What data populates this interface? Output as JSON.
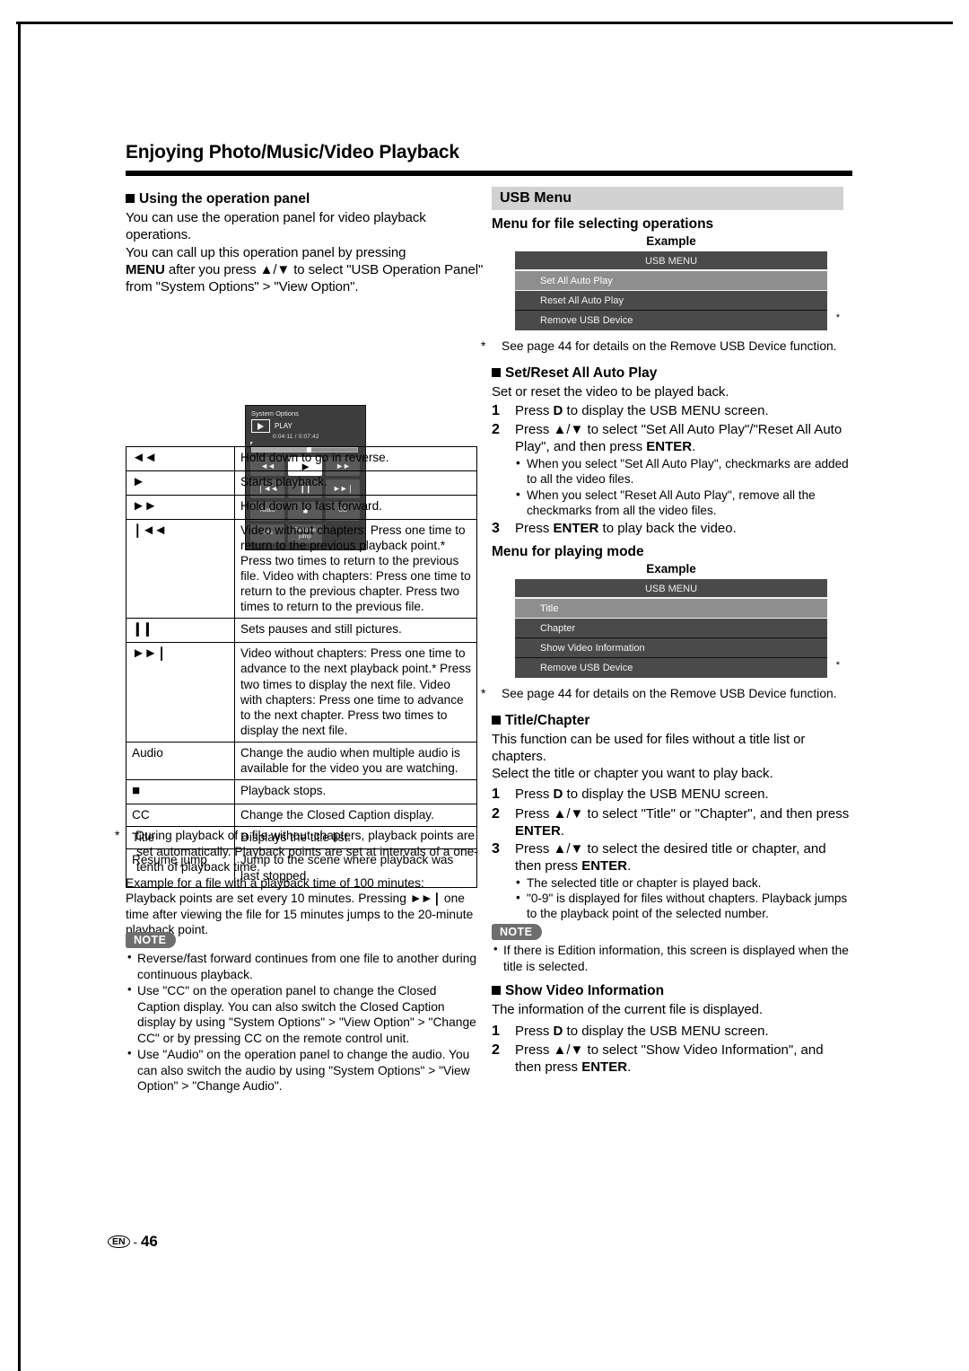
{
  "page": {
    "chapter_title": "Enjoying Photo/Music/Video Playback",
    "footer_lang": "EN",
    "footer_dash": "-",
    "footer_page": "46"
  },
  "left": {
    "section_heading": "Using the operation panel",
    "intro_1": "You can use the operation panel for video playback operations.",
    "intro_2": "You can call up this operation panel by pressing",
    "intro_3_bold": "MENU",
    "intro_3_rest": " after you press ▲/▼ to select \"USB Operation Panel\" from \"System Options\" > \"View Option\".",
    "op_panel": {
      "title": "System Options",
      "play_label": "PLAY",
      "time": "0:04:11 / 0:07:42",
      "buttons": {
        "rew": "◄◄",
        "play": "►",
        "ff": "►►",
        "prev": "❘◄◄",
        "pause": "❙❙",
        "next": "►►❘",
        "audio": "Audio",
        "stop": "■",
        "cc": "CC",
        "title": "Title",
        "resume": "Resume jump"
      }
    },
    "table": {
      "rows": [
        {
          "key": "◄◄",
          "key_is_icon": true,
          "desc": "Hold down to go in reverse."
        },
        {
          "key": "►",
          "key_is_icon": true,
          "desc": "Starts playback."
        },
        {
          "key": "►►",
          "key_is_icon": true,
          "desc": "Hold down to fast forward."
        },
        {
          "key": "❘◄◄",
          "key_is_icon": true,
          "desc": "Video without chapters: Press one time to return to the previous playback point.* Press two times to return to the previous file. Video with chapters: Press one time to return to the previous chapter. Press two times to return to the previous file."
        },
        {
          "key": "❙❙",
          "key_is_icon": true,
          "desc": "Sets pauses and still pictures."
        },
        {
          "key": "►►❘",
          "key_is_icon": true,
          "desc": "Video without chapters: Press one time to advance to the next playback point.* Press two times to display the next file. Video with chapters: Press one time to advance to the next chapter. Press two times to display the next file."
        },
        {
          "key": "Audio",
          "key_is_icon": false,
          "desc": "Change the audio when multiple audio is available for the video you are watching."
        },
        {
          "key": "■",
          "key_is_icon": true,
          "desc": "Playback stops."
        },
        {
          "key": "CC",
          "key_is_icon": false,
          "desc": "Change the Closed Caption display."
        },
        {
          "key": "Title",
          "key_is_icon": false,
          "desc": "Displays the title list."
        },
        {
          "key": "Resume jump",
          "key_is_icon": false,
          "desc": "Jump to the scene where playback was last stopped."
        }
      ]
    },
    "footnote_star": "*",
    "footnote_text": "During playback of a file without chapters, playback points are set automatically. Playback points are set at intervals of a one-tenth of playback time.",
    "footnote_example_1": "Example for a file with a playback time of 100 minutes:",
    "footnote_example_2a": "Playback points are set every 10 minutes. Pressing ",
    "footnote_example_2b": "►►❘",
    "footnote_example_2c": " one time after viewing the file for 15 minutes jumps to the 20-minute playback point.",
    "note_badge": "NOTE",
    "notes": [
      "Reverse/fast forward continues from one file to another during continuous playback.",
      "Use \"CC\" on the operation panel to change the Closed Caption display. You can also switch the Closed Caption display by using \"System Options\" > \"View Option\" > \"Change CC\" or by pressing CC on the remote control unit.",
      "Use \"Audio\" on the operation panel to change the audio. You can also switch the audio by using \"System Options\" > \"View Option\" > \"Change Audio\"."
    ]
  },
  "right": {
    "usb_menu_bar": "USB Menu",
    "file_select_heading": "Menu for file selecting operations",
    "example_label_1": "Example",
    "menu_1": {
      "header": "USB MENU",
      "items": [
        "Set All Auto Play",
        "Reset All Auto Play",
        "Remove USB Device"
      ],
      "star": "*"
    },
    "footnote_1": "See page 44 for details on the Remove USB Device function.",
    "set_reset_heading": "Set/Reset All Auto Play",
    "set_reset_intro": "Set or reset the video to be played back.",
    "set_reset_steps": [
      {
        "num": "1",
        "text": "Press D to display the USB MENU screen."
      },
      {
        "num": "2",
        "text": "Press ▲/▼ to select \"Set All Auto Play\"/\"Reset All Auto Play\", and then press ENTER."
      },
      {
        "num": "3",
        "text": "Press ENTER to play back the video."
      }
    ],
    "set_reset_bullets": [
      "When you select \"Set All Auto Play\", checkmarks are added to all the video files.",
      "When you select \"Reset All Auto Play\", remove all the checkmarks from all the video files."
    ],
    "playing_mode_heading": "Menu for playing mode",
    "example_label_2": "Example",
    "menu_2": {
      "header": "USB MENU",
      "items": [
        "Title",
        "Chapter",
        "Show Video Information",
        "Remove USB Device"
      ],
      "star": "*"
    },
    "footnote_2": "See page 44 for details on the Remove USB Device function.",
    "title_chapter_heading": "Title/Chapter",
    "title_chapter_intro_1": "This function can be used for files without a title list or chapters.",
    "title_chapter_intro_2": "Select the title or chapter you want to play back.",
    "title_chapter_steps": [
      {
        "num": "1",
        "text": "Press D to display the USB MENU screen."
      },
      {
        "num": "2",
        "text": "Press ▲/▼ to select \"Title\" or \"Chapter\", and then press ENTER."
      },
      {
        "num": "3",
        "text": "Press ▲/▼ to select the desired title or chapter, and then press ENTER."
      }
    ],
    "title_chapter_bullets": [
      "The selected title or chapter is played back.",
      "\"0-9\" is displayed for files without chapters. Playback jumps to the playback point of the selected number."
    ],
    "note_badge": "NOTE",
    "note_item": "If there is Edition information, this screen is displayed when the title is selected.",
    "show_info_heading": "Show Video Information",
    "show_info_intro": "The information of the current file is displayed.",
    "show_info_steps": [
      {
        "num": "1",
        "text": "Press D to display the USB MENU screen."
      },
      {
        "num": "2",
        "text": "Press ▲/▼ to select \"Show Video Information\", and then press ENTER."
      }
    ]
  }
}
